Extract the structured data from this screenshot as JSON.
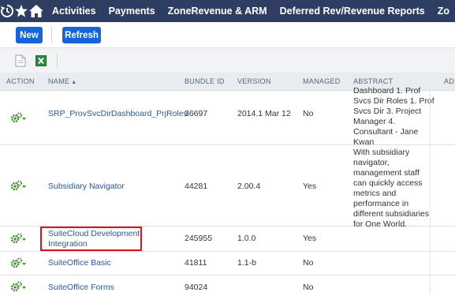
{
  "nav": {
    "items": [
      "Activities",
      "Payments",
      "ZoneRevenue & ARM",
      "Deferred Rev/Revenue Reports",
      "Zo"
    ]
  },
  "buttons": {
    "new_label": "New",
    "refresh_label": "Refresh"
  },
  "table": {
    "headers": [
      "ACTION",
      "NAME",
      "BUNDLE ID",
      "VERSION",
      "MANAGED",
      "ABSTRACT",
      "ADM"
    ],
    "sort_indicator": "▲",
    "rows": [
      {
        "name": "SRP_ProvSvcDirDashboard_PrjRoles",
        "bundle_id": "36697",
        "version": "2014.1 Mar 12",
        "managed": "No",
        "abstract": [
          "Dashboard 1. Prof",
          "Svcs Dir Roles 1. Prof",
          "Svcs Dir 3. Project",
          "Manager 4.",
          "Consultant - Jane",
          "Kwan"
        ]
      },
      {
        "name": "Subsidiary Navigator",
        "bundle_id": "44281",
        "version": "2.00.4",
        "managed": "Yes",
        "abstract": [
          "With subsidiary",
          "navigator,",
          "management staff",
          "can quickly access",
          "metrics and",
          "performance in",
          "different subsidiaries",
          "for One World."
        ]
      },
      {
        "name_lines": [
          "SuiteCloud Development",
          "Integration"
        ],
        "bundle_id": "245955",
        "version": "1.0.0",
        "managed": "Yes",
        "abstract": []
      },
      {
        "name": "SuiteOffice Basic",
        "bundle_id": "41811",
        "version": "1.1-b",
        "managed": "No",
        "abstract": []
      },
      {
        "name": "SuiteOffice Forms",
        "bundle_id": "94024",
        "version": "",
        "managed": "No",
        "abstract": []
      }
    ]
  },
  "icons": {
    "nav": [
      "recent-history-icon",
      "star-icon",
      "home-icon"
    ],
    "toolbar": [
      "document-icon",
      "export-excel-icon"
    ],
    "row_action": "gear-action-icon"
  },
  "colors": {
    "nav_bg": "#2e3e62",
    "button_bg": "#1565d8",
    "link": "#2c5699",
    "highlight": "#e0101a",
    "header_bg": "#e9ecef"
  }
}
